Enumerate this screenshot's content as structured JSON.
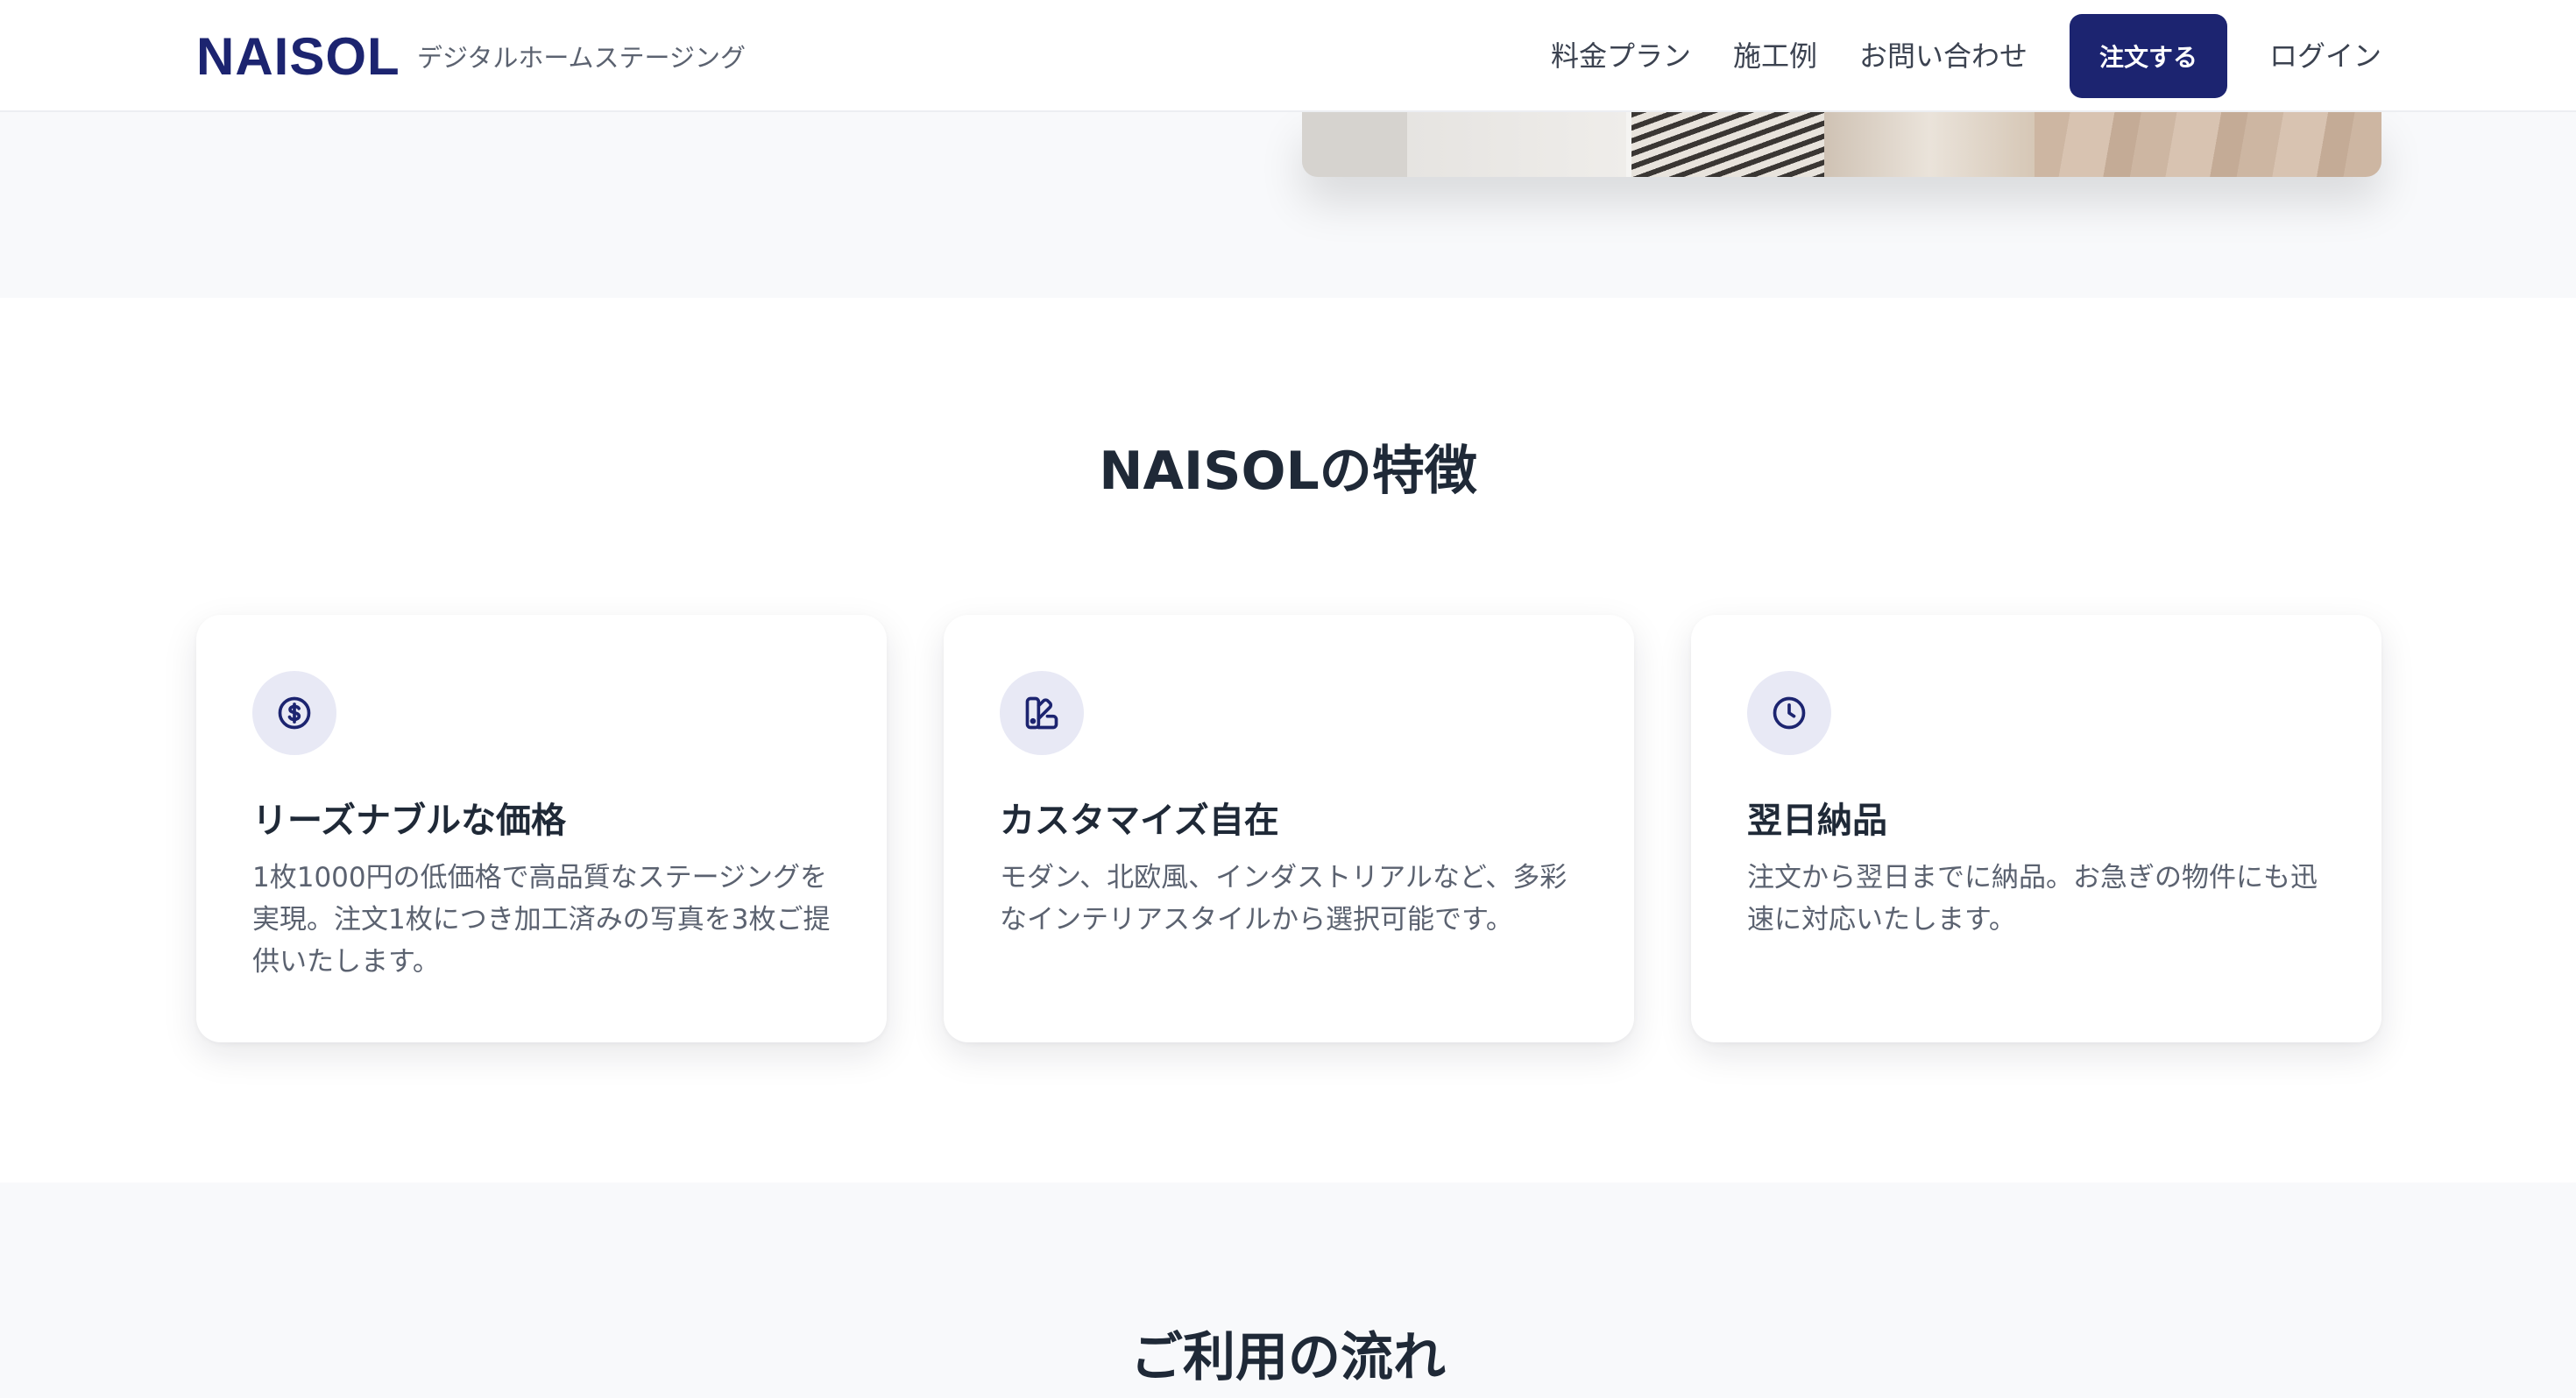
{
  "header": {
    "logo": "NAISOL",
    "tagline": "デジタルホームステージング",
    "nav": [
      {
        "label": "料金プラン"
      },
      {
        "label": "施工例"
      },
      {
        "label": "お問い合わせ"
      }
    ],
    "order_label": "注文する",
    "login_label": "ログイン"
  },
  "features": {
    "title": "NAISOLの特徴",
    "cards": [
      {
        "icon": "dollar-circle-icon",
        "title": "リーズナブルな価格",
        "desc": "1枚1000円の低価格で高品質なステージングを実現。注文1枚につき加工済みの写真を3枚ご提供いたします。"
      },
      {
        "icon": "palette-icon",
        "title": "カスタマイズ自在",
        "desc": "モダン、北欧風、インダストリアルなど、多彩なインテリアスタイルから選択可能です。"
      },
      {
        "icon": "clock-icon",
        "title": "翌日納品",
        "desc": "注文から翌日までに納品。お急ぎの物件にも迅速に対応いたします。"
      }
    ]
  },
  "flow": {
    "title": "ご利用の流れ"
  },
  "colors": {
    "brand": "#1c2470",
    "icon_bg": "#e8e9f5",
    "section_bg": "#f8f9fb"
  }
}
